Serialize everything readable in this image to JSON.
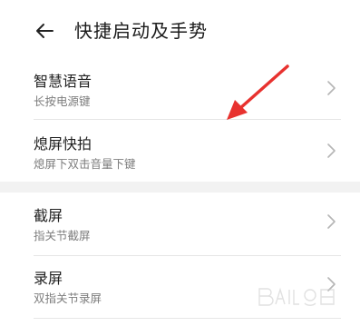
{
  "header": {
    "back_icon": "arrow-left-icon",
    "title": "快捷启动及手势"
  },
  "sections": [
    {
      "items": [
        {
          "title": "智慧语音",
          "subtitle": "长按电源键"
        },
        {
          "title": "熄屏快拍",
          "subtitle": "熄屏下双击音量下键"
        }
      ]
    },
    {
      "items": [
        {
          "title": "截屏",
          "subtitle": "指关节截屏"
        },
        {
          "title": "录屏",
          "subtitle": "双指关节录屏"
        }
      ]
    }
  ],
  "icons": {
    "chevron": "chevron-right-icon",
    "back": "arrow-left-icon"
  },
  "colors": {
    "annotation_arrow": "#e8322f",
    "section_gap": "#f2f2f2",
    "title_text": "#1b1b1b",
    "subtitle_text": "#7d7d7d"
  },
  "watermark": {
    "logo": "baidu-jingyan-watermark"
  }
}
